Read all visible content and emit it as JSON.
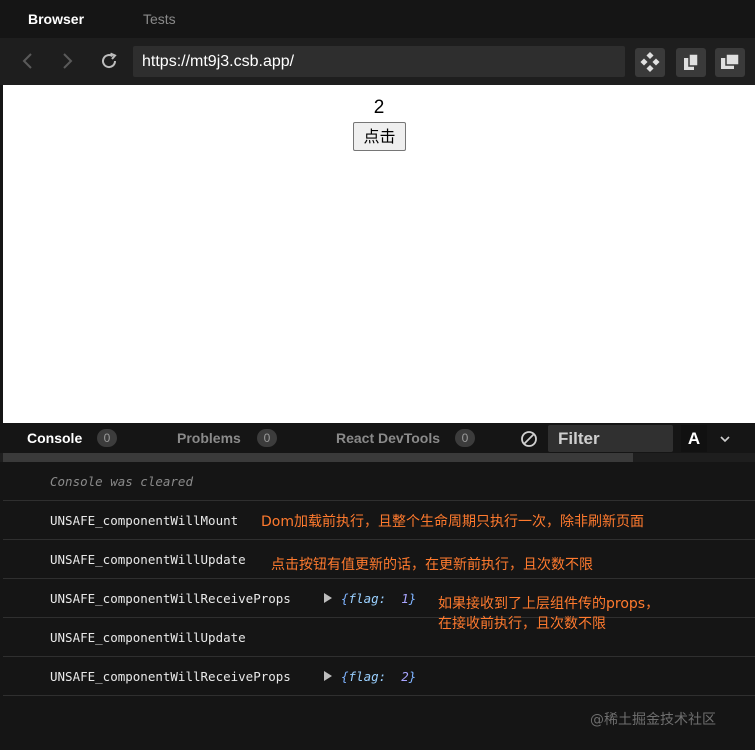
{
  "tabs": {
    "browser": "Browser",
    "tests": "Tests"
  },
  "toolbar": {
    "url": "https://mt9j3.csb.app/",
    "icons": [
      "back-icon",
      "forward-icon",
      "refresh-icon",
      "devtools-icon",
      "copy-icon",
      "open-window-icon"
    ]
  },
  "preview": {
    "count": "2",
    "button_label": "点击"
  },
  "devtools": {
    "tabs": [
      {
        "label": "Console",
        "count": "0"
      },
      {
        "label": "Problems",
        "count": "0"
      },
      {
        "label": "React DevTools",
        "count": "0"
      }
    ],
    "filter_placeholder": "Filter",
    "font_toggle": "A"
  },
  "console": {
    "cleared": "Console was cleared",
    "rows": [
      {
        "message": "UNSAFE_componentWillMount"
      },
      {
        "message": "UNSAFE_componentWillUpdate"
      },
      {
        "message": "UNSAFE_componentWillReceiveProps",
        "obj_open": "{",
        "obj_key": "flag:",
        "obj_value": "1",
        "obj_close": "}"
      },
      {
        "message": "UNSAFE_componentWillUpdate"
      },
      {
        "message": "UNSAFE_componentWillReceiveProps",
        "obj_open": "{",
        "obj_key": "flag:",
        "obj_value": "2",
        "obj_close": "}"
      }
    ]
  },
  "annotations": {
    "mount": "Dom加载前执行，且整个生命周期只执行一次，除非刷新页面",
    "update": "点击按钮有值更新的话，在更新前执行，且次数不限",
    "receive_line1": "如果接收到了上层组件传的props，",
    "receive_line2": "在接收前执行，且次数不限"
  },
  "watermark": "@稀土掘金技术社区",
  "colors": {
    "annotation": "#ff7a2e",
    "console_bg": "#151515",
    "accent_value": "#a9a5ff"
  }
}
